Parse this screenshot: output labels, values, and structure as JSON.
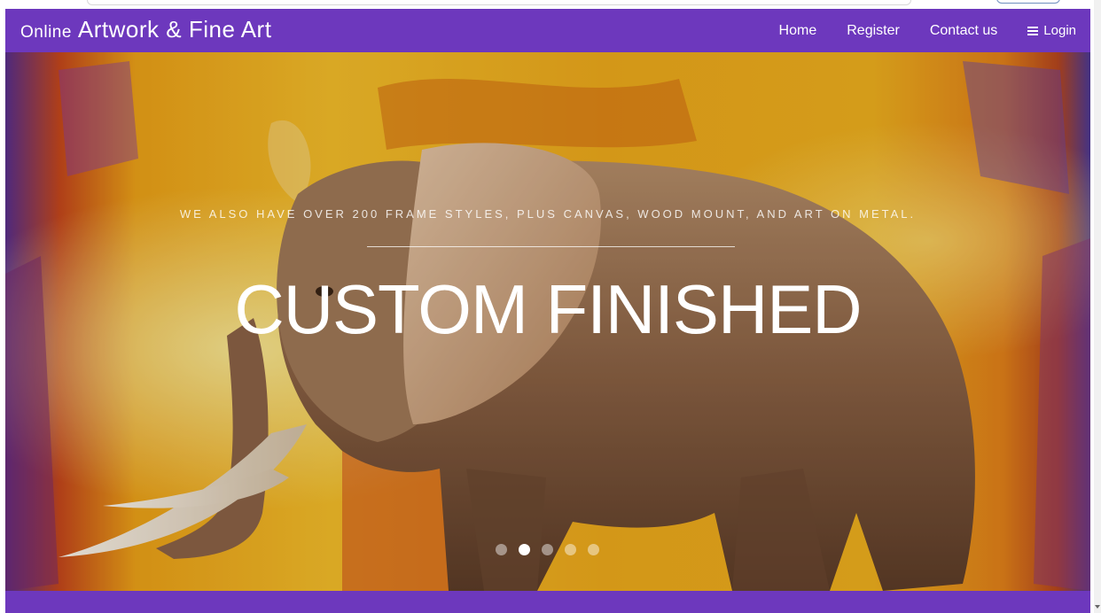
{
  "brand": {
    "prefix": "Online",
    "name": "Artwork & Fine Art"
  },
  "nav": {
    "items": [
      "Home",
      "Register",
      "Contact us"
    ],
    "login_label": "Login"
  },
  "hero": {
    "tagline": "WE ALSO HAVE OVER 200 FRAME STYLES, PLUS CANVAS, WOOD MOUNT, AND ART ON METAL.",
    "headline": "CUSTOM FINISHED",
    "image": "elephant-painting",
    "slide_count": 5,
    "active_slide": 2
  },
  "colors": {
    "accent": "#6d38bd",
    "painting_yellow": "#f2b515",
    "painting_orange": "#e0760f",
    "elephant_brown": "#8e6447"
  }
}
